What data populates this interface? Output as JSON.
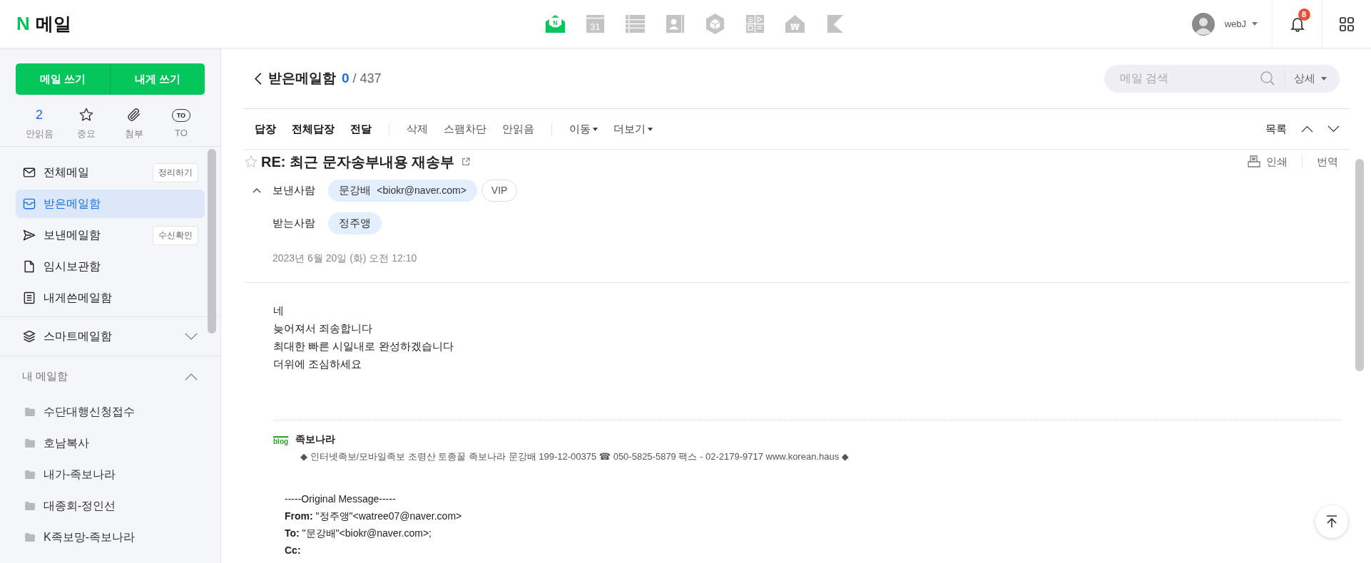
{
  "app": {
    "logo_letter": "N",
    "title": "메일"
  },
  "app_switcher": [
    {
      "kind": "mail",
      "mark": "N",
      "selected": true
    },
    {
      "kind": "calendar",
      "mark": "31",
      "selected": false
    },
    {
      "kind": "table",
      "selected": false
    },
    {
      "kind": "contacts",
      "selected": false
    },
    {
      "kind": "box",
      "selected": false
    },
    {
      "kind": "forms",
      "selected": false
    },
    {
      "kind": "pay",
      "mark": "₩",
      "selected": false
    },
    {
      "kind": "flag",
      "selected": false
    }
  ],
  "user": {
    "name": "webJ"
  },
  "notifications": {
    "count": "8"
  },
  "compose_buttons": [
    "메일 쓰기",
    "내게 쓰기"
  ],
  "quick_filters": [
    {
      "kind": "count",
      "value": "2",
      "label": "안읽음"
    },
    {
      "kind": "star",
      "label": "중요"
    },
    {
      "kind": "clip",
      "label": "첨부"
    },
    {
      "kind": "to",
      "mark": "TO",
      "label": "TO"
    }
  ],
  "mailboxes": [
    {
      "kind": "all",
      "label": "전체메일",
      "action": "정리하기",
      "selected": false
    },
    {
      "kind": "inbox",
      "label": "받은메일함",
      "selected": true
    },
    {
      "kind": "sent",
      "label": "보낸메일함",
      "action": "수신확인",
      "selected": false
    },
    {
      "kind": "drafts",
      "label": "임시보관함",
      "selected": false
    },
    {
      "kind": "self",
      "label": "내게쓴메일함",
      "selected": false
    }
  ],
  "smart_mailbox": {
    "label": "스마트메일함",
    "expanded": false
  },
  "my_mailboxes": {
    "label": "내 메일함",
    "expanded": true,
    "folders": [
      "수단대행신청접수",
      "호남복사",
      "내가-족보나라",
      "대종회-정인선",
      "K족보망-족보나라"
    ]
  },
  "mailbox_header": {
    "title": "받은메일함",
    "unread": "0",
    "total": "/ 437"
  },
  "search": {
    "placeholder": "메일 검색",
    "detail": "상세"
  },
  "toolbar": {
    "groups": [
      {
        "kind": "primary",
        "items": [
          "답장",
          "전체답장",
          "전달"
        ]
      },
      {
        "kind": "secondary",
        "items": [
          "삭제",
          "스팸차단",
          "안읽음"
        ]
      },
      {
        "kind": "dropdown",
        "items": [
          "이동",
          "더보기"
        ]
      }
    ],
    "list": "목록"
  },
  "message": {
    "starred": false,
    "subject": "RE: 최근 문자송부내용 재송부",
    "print": "인쇄",
    "translate": "번역",
    "header_expanded": true,
    "from_label": "보낸사람",
    "from": {
      "name": "문강배",
      "email": "<biokr@naver.com>"
    },
    "vip": "VIP",
    "to_label": "받는사람",
    "to": [
      "정주앵"
    ],
    "date": "2023년 6월 20일 (화) 오전 12:10",
    "body": [
      "네",
      "늦어져서 죄송합니다",
      "최대한 빠른 시일내로 완성하겠습니다",
      "더위에 조심하세요"
    ],
    "signature": {
      "badge": "blog",
      "name": "족보나라",
      "text": "◆ 인터넷족보/모바일족보 조령산 토종꿀 족보나라 문강배 199-12-00375 ☎ 050-5825-5879 팩스 - 02-2179-9717 www.korean.haus ◆"
    },
    "original": {
      "header": "-----Original Message-----",
      "fields": [
        {
          "label": "From:",
          "value": "\"정주앵\"<watree07@naver.com>"
        },
        {
          "label": "To:",
          "value": "\"문강배\"<biokr@naver.com>;"
        },
        {
          "label": "Cc:"
        }
      ]
    }
  }
}
